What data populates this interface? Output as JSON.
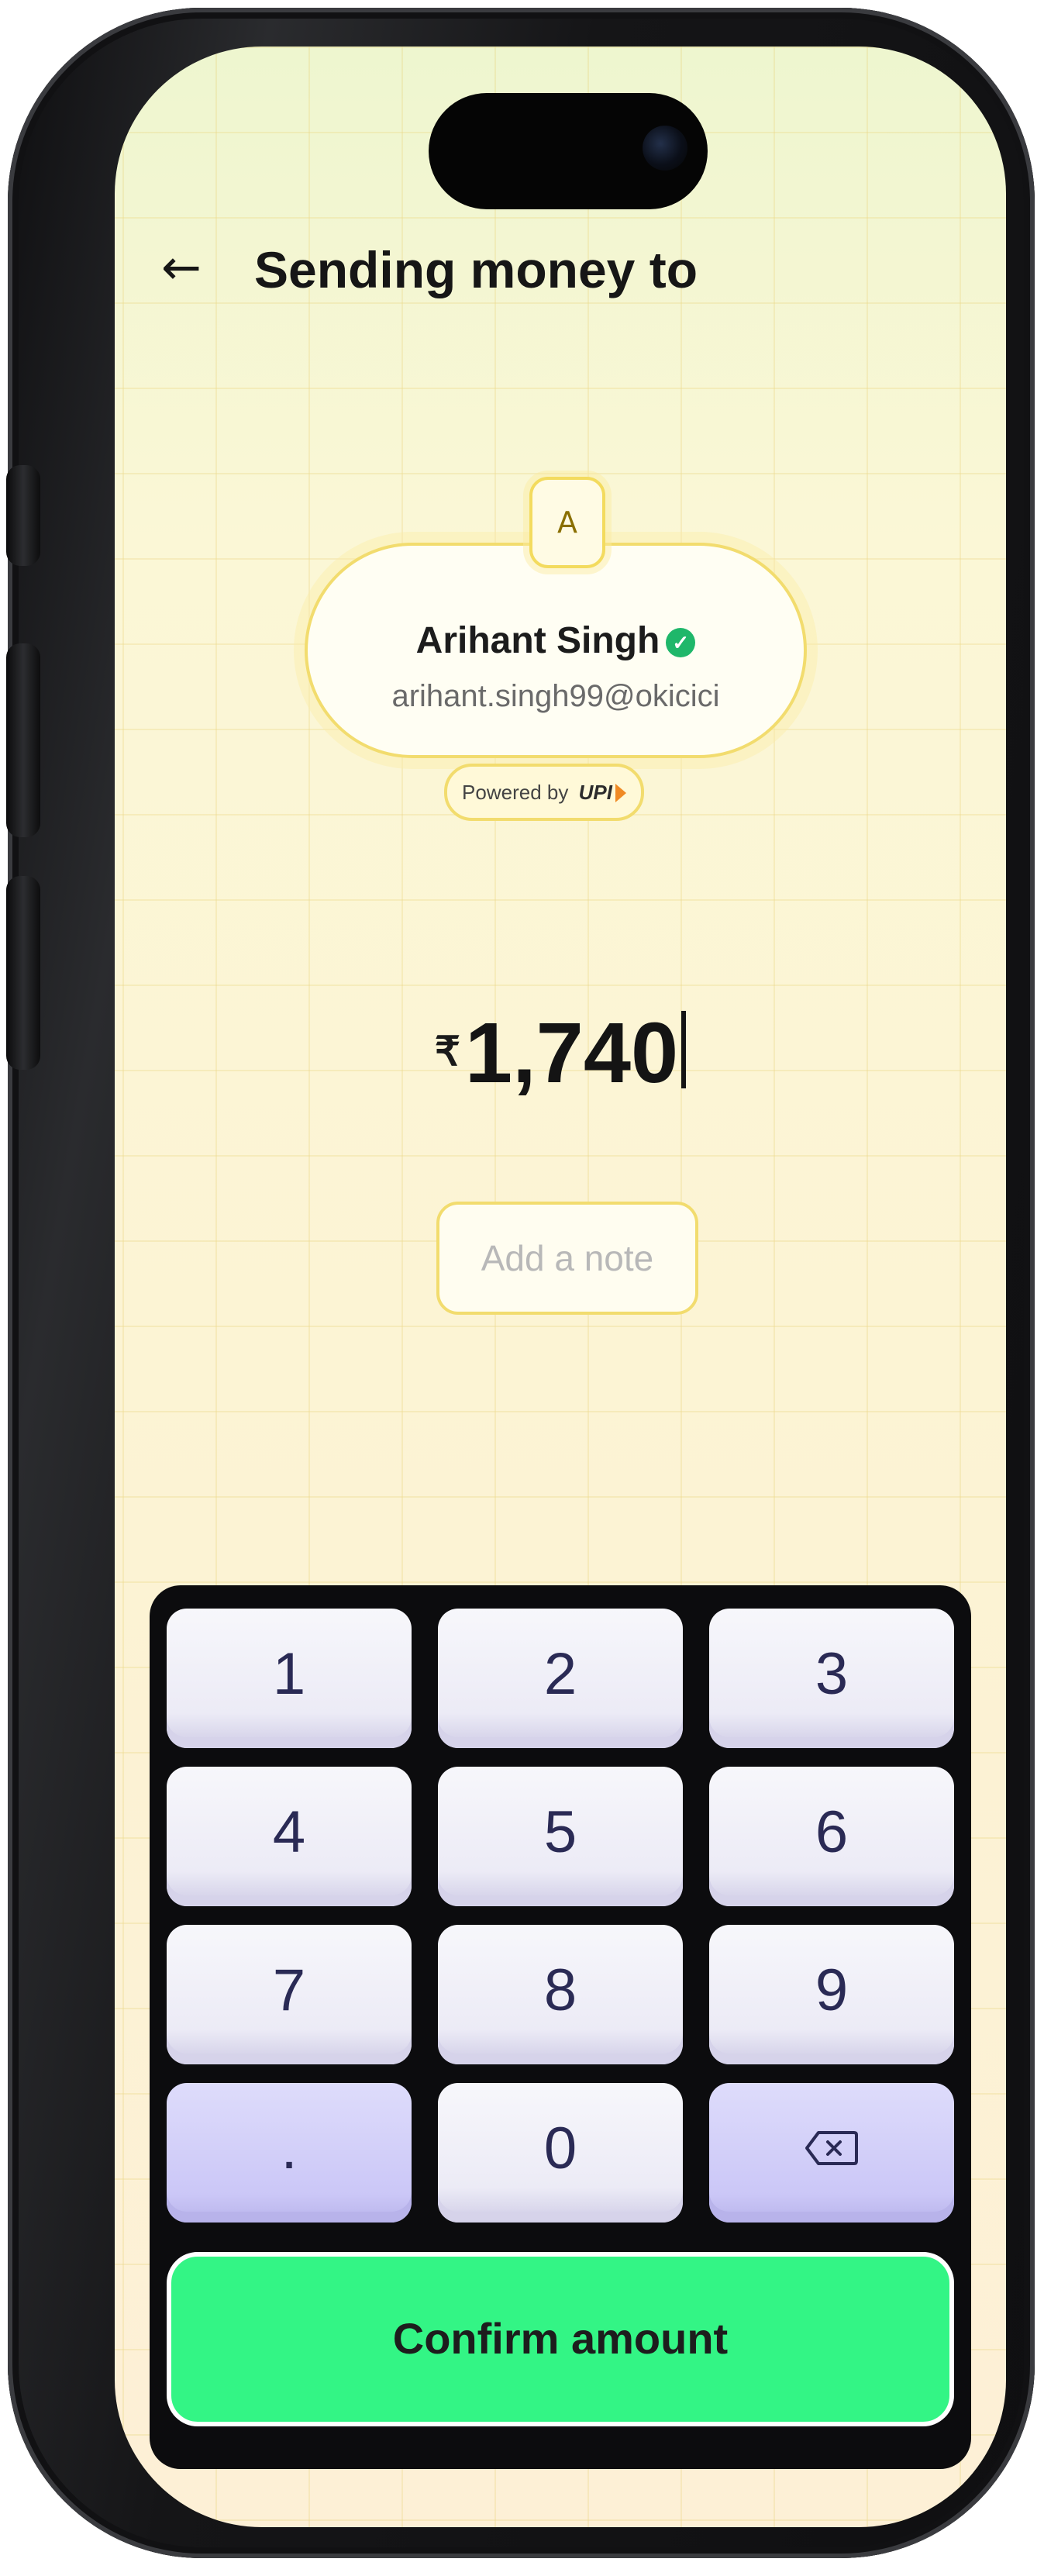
{
  "header": {
    "back_icon": "arrow-left-icon",
    "title": "Sending money to"
  },
  "recipient": {
    "avatar_initial": "A",
    "name": "Arihant Singh",
    "verified_icon": "verified-check-icon",
    "upi_id": "arihant.singh99@okicici",
    "powered_by": "Powered by",
    "upi_brand": "UPI"
  },
  "amount": {
    "currency_symbol": "₹",
    "value": "1,740"
  },
  "note": {
    "placeholder": "Add a note"
  },
  "keypad": {
    "keys": [
      "1",
      "2",
      "3",
      "4",
      "5",
      "6",
      "7",
      "8",
      "9",
      ".",
      "0"
    ],
    "backspace_icon": "backspace-icon"
  },
  "confirm": {
    "label": "Confirm amount"
  },
  "colors": {
    "accent_green": "#33f585",
    "card_border": "#f2dc6e",
    "key_text": "#2a2a55",
    "alt_key": "#cbc7f7"
  }
}
